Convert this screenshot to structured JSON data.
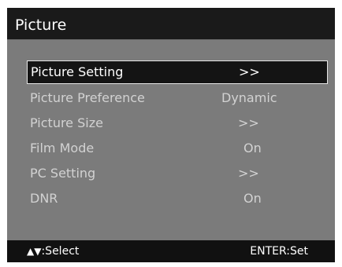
{
  "menu": {
    "title": "Picture",
    "items": [
      {
        "label": "Picture Setting",
        "value": ">>",
        "selected": true
      },
      {
        "label": "Picture Preference",
        "value": "Dynamic",
        "selected": false
      },
      {
        "label": "Picture Size",
        "value": ">>",
        "selected": false
      },
      {
        "label": "Film Mode",
        "value": "On",
        "selected": false
      },
      {
        "label": "PC Setting",
        "value": ">>",
        "selected": false
      },
      {
        "label": "DNR",
        "value": "On",
        "selected": false
      }
    ]
  },
  "footer": {
    "nav_arrows": "▲▼",
    "nav_text": ":Select",
    "enter_text": "ENTER:Set"
  },
  "colors": {
    "panel_background": "#7b7b7b",
    "title_background": "#1a1a1a",
    "footer_background": "#111111",
    "selection_background": "#141414",
    "selection_border": "#e8e8e8",
    "item_text": "#d2d2d2"
  }
}
